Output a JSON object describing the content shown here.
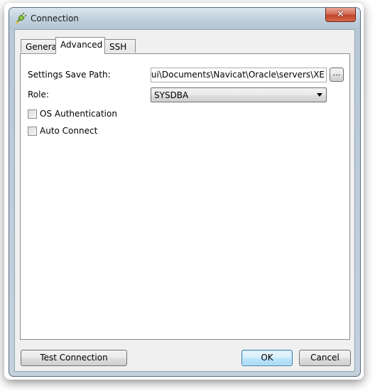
{
  "window": {
    "title": "Connection",
    "close_glyph": "✕"
  },
  "tabs": [
    {
      "label": "General",
      "active": false
    },
    {
      "label": "Advanced",
      "active": true
    },
    {
      "label": "SSH",
      "active": false
    }
  ],
  "advanced": {
    "save_path_label": "Settings Save Path:",
    "save_path_value": "ers\\Jui\\Documents\\Navicat\\Oracle\\servers\\XE",
    "browse_label": "...",
    "role_label": "Role:",
    "role_value": "SYSDBA",
    "os_auth_label": "OS Authentication",
    "auto_connect_label": "Auto Connect"
  },
  "buttons": {
    "test_connection": "Test Connection",
    "ok": "OK",
    "cancel": "Cancel"
  },
  "colors": {
    "accent": "#3c7fb1",
    "close_red": "#c2452b"
  }
}
